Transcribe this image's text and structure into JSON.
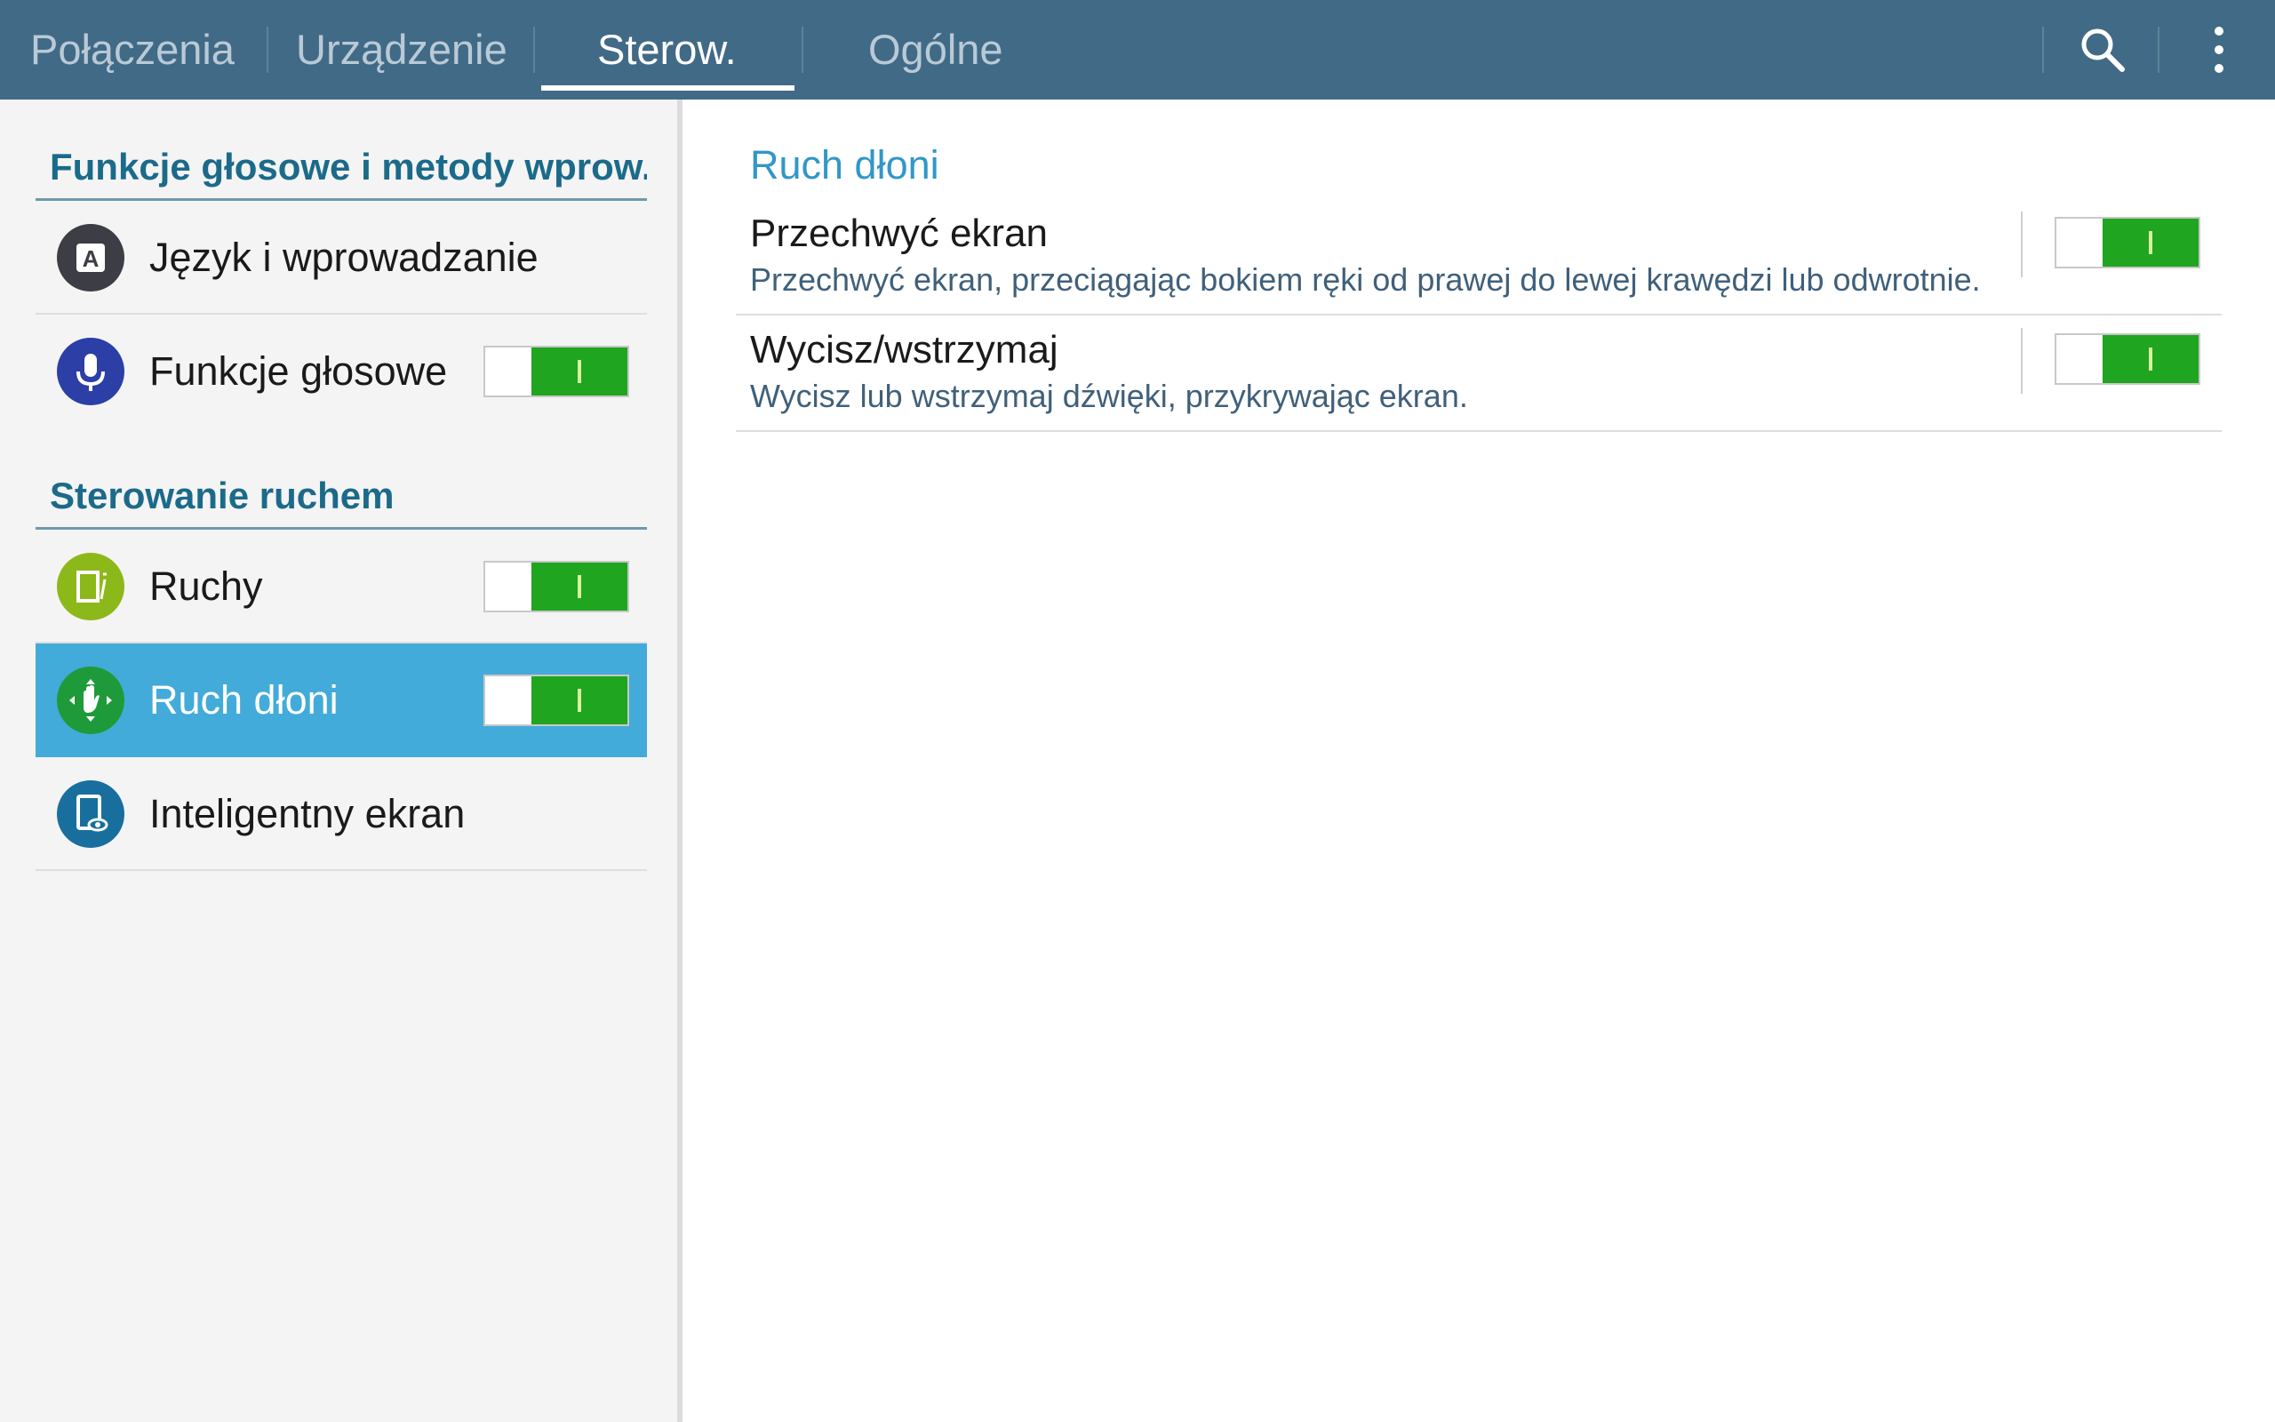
{
  "tabs": [
    {
      "label": "Połączenia",
      "active": false
    },
    {
      "label": "Urządzenie",
      "active": false
    },
    {
      "label": "Sterow.",
      "active": true
    },
    {
      "label": "Ogólne",
      "active": false
    }
  ],
  "actionbar": {
    "icons": [
      "search-icon",
      "overflow-menu-icon"
    ]
  },
  "colors": {
    "actionbar": "#416a87",
    "selected_item": "#43abd9",
    "switch_on": "#1fa51f",
    "section_header": "#1b6a8a",
    "right_header": "#3197c8"
  },
  "sidebar": {
    "sections": [
      {
        "header": "Funkcje głosowe i metody wprow...",
        "items": [
          {
            "label": "Język i wprowadzanie",
            "icon": "language-icon",
            "icon_glyph": "A"
          },
          {
            "label": "Funkcje głosowe",
            "icon": "microphone-icon",
            "switch_on": true
          }
        ]
      },
      {
        "header": "Sterowanie ruchem",
        "items": [
          {
            "label": "Ruchy",
            "icon": "motion-icon",
            "switch_on": true
          },
          {
            "label": "Ruch dłoni",
            "icon": "palm-motion-icon",
            "switch_on": true,
            "selected": true
          },
          {
            "label": "Inteligentny ekran",
            "icon": "smart-screen-icon"
          }
        ]
      }
    ]
  },
  "detail": {
    "header": "Ruch dłoni",
    "settings": [
      {
        "title": "Przechwyć ekran",
        "summary": "Przechwyć ekran, przeciągając bokiem ręki od prawej do lewej krawędzi lub odwrotnie.",
        "switch_on": true
      },
      {
        "title": "Wycisz/wstrzymaj",
        "summary": "Wycisz lub wstrzymaj dźwięki, przykrywając ekran.",
        "switch_on": true
      }
    ]
  }
}
